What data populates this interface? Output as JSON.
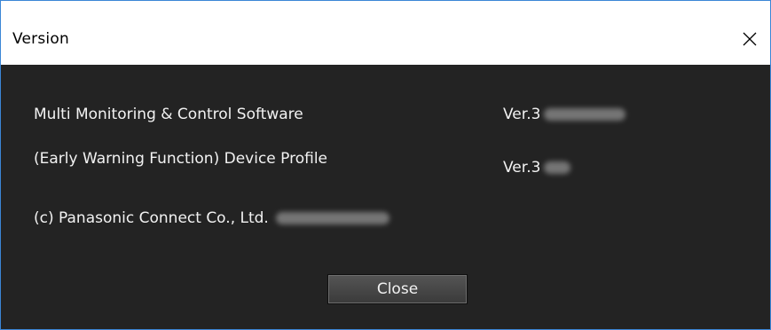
{
  "window": {
    "title": "Version"
  },
  "content": {
    "product_name": "Multi Monitoring & Control Software",
    "product_version_prefix": "Ver.3",
    "profile_name": "(Early Warning Function) Device Profile",
    "profile_version_prefix": "Ver.3",
    "copyright": "(c) Panasonic Connect Co., Ltd."
  },
  "buttons": {
    "close_label": "Close"
  },
  "icons": {
    "window_close": "close-icon"
  },
  "colors": {
    "titlebar_bg": "#ffffff",
    "content_bg": "#232323",
    "text": "#f2f2f2",
    "window_border": "#3b86d6",
    "button_bg": "#474747"
  }
}
